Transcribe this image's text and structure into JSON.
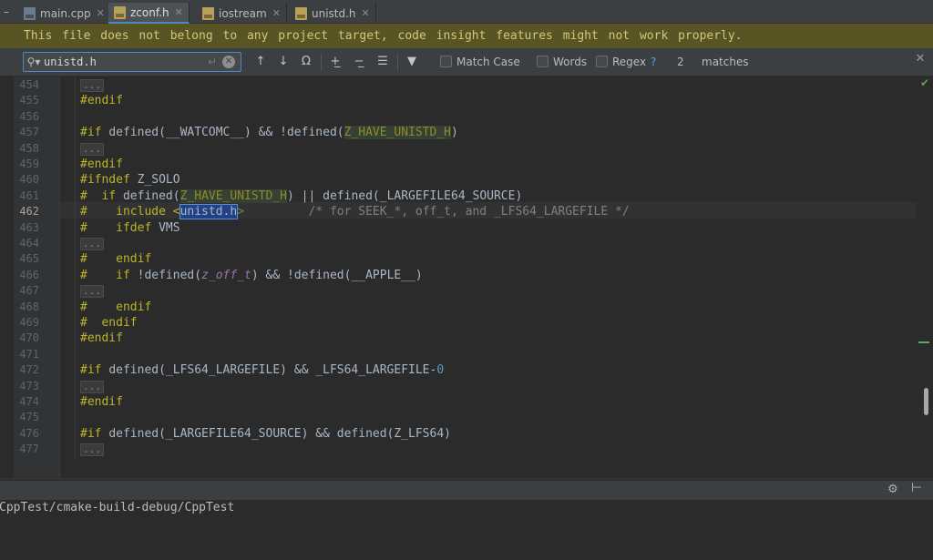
{
  "tabs": [
    {
      "label": "main.cpp",
      "icon": "cpp-file-icon",
      "active": false
    },
    {
      "label": "zconf.h",
      "icon": "header-file-icon",
      "active": true
    },
    {
      "label": "iostream",
      "icon": "header-file-icon",
      "active": false
    },
    {
      "label": "unistd.h",
      "icon": "header-file-icon",
      "active": false
    }
  ],
  "tab_edge_label": "–",
  "banner": {
    "text": "This file does not belong to any project target, code insight features might not work properly."
  },
  "findbar": {
    "query": "unistd.h",
    "match_case_label": "Match Case",
    "words_label": "Words",
    "regex_label": "Regex",
    "help": "?",
    "match_count": "2",
    "matches_label": "matches"
  },
  "gutter": {
    "lines": [
      "454",
      "455",
      "456",
      "457",
      "458",
      "459",
      "460",
      "461",
      "462",
      "463",
      "464",
      "465",
      "466",
      "467",
      "468",
      "469",
      "470",
      "471",
      "472",
      "473",
      "474",
      "475",
      "476",
      "477"
    ],
    "current_line": "462"
  },
  "code": {
    "fold_text": "...",
    "l455": "#endif",
    "l457_a": "#if ",
    "l457_b": "defined(__WATCOMC__) && !defined(",
    "l457_c": "Z_HAVE_UNISTD_H",
    "l457_d": ")",
    "l459": "#endif",
    "l460_a": "#ifndef ",
    "l460_b": "Z_SOLO",
    "l461_a": "#  if ",
    "l461_b": "defined(",
    "l461_c": "Z_HAVE_UNISTD_H",
    "l461_d": ") || defined(_LARGEFILE64_SOURCE)",
    "l462_a": "#    include <",
    "l462_b": "unistd.h",
    "l462_c": ">",
    "l462_d": "         /* for SEEK_*, off_t, and _LFS64_LARGEFILE */",
    "l463_a": "#    ifdef ",
    "l463_b": "VMS",
    "l465": "#    endif",
    "l466_a": "#    if ",
    "l466_b": "!defined(",
    "l466_c": "z_off_t",
    "l466_d": ") && !defined(__APPLE__)",
    "l468": "#    endif",
    "l469": "#  endif",
    "l470": "#endif",
    "l472_a": "#if ",
    "l472_b": "defined(_LFS64_LARGEFILE) && _LFS64_LARGEFILE-",
    "l472_c": "0",
    "l474": "#endif",
    "l476_a": "#if ",
    "l476_b": "defined(_LARGEFILE64_SOURCE) && defined(Z_LFS64)"
  },
  "console": {
    "path": "CppTest/cmake-build-debug/CppTest"
  },
  "colors": {
    "banner_bg": "#595423",
    "banner_text": "#d2c67e",
    "accent": "#4a88c7",
    "preprocessor": "#bbb529",
    "search_hit": "#214283"
  }
}
